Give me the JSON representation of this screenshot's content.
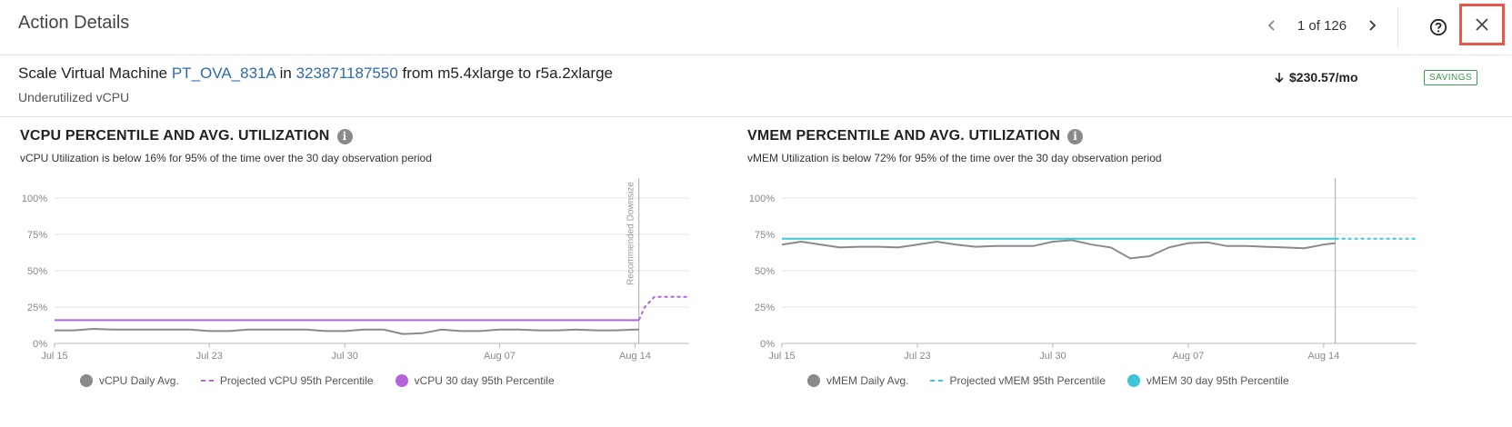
{
  "header": {
    "title": "Action Details",
    "pager_text": "1 of 126"
  },
  "summary": {
    "prefix": "Scale Virtual Machine ",
    "vm_link": "PT_OVA_831A",
    "in_text": " in ",
    "account_link": "323871187550",
    "suffix": " from m5.4xlarge to r5a.2xlarge",
    "reason": "Underutilized vCPU",
    "savings": "$230.57/mo",
    "badge": "SAVINGS"
  },
  "colors": {
    "link": "#2f6aa8",
    "daily_avg": "#8a8a8a",
    "vcpu_95th": "#b465dd",
    "vmem_95th": "#3fc5d6",
    "savings_badge": "#3f9a4a",
    "close_highlight": "#e8574c"
  },
  "icons": [
    "chevron-left-icon",
    "chevron-right-icon",
    "help-icon",
    "close-icon",
    "info-icon",
    "arrow-down-icon"
  ],
  "vcpu_panel": {
    "title": "VCPU PERCENTILE AND AVG. UTILIZATION",
    "subtitle": "vCPU Utilization is below 16% for 95% of the time over the 30 day observation period",
    "legend": [
      "vCPU Daily Avg.",
      "Projected vCPU 95th Percentile",
      "vCPU 30 day 95th Percentile"
    ]
  },
  "vmem_panel": {
    "title": "VMEM PERCENTILE AND AVG. UTILIZATION",
    "subtitle": "vMEM Utilization is below 72% for 95% of the time over the 30 day observation period",
    "legend": [
      "vMEM Daily Avg.",
      "Projected vMEM 95th Percentile",
      "vMEM 30 day 95th Percentile"
    ]
  },
  "chart_data": [
    {
      "type": "line",
      "yticks": [
        "100%",
        "75%",
        "50%",
        "25%",
        "0%"
      ],
      "ylim": [
        0,
        100
      ],
      "xlim": [
        0,
        32.8
      ],
      "xticks": [
        {
          "label": "Jul 15",
          "x": 0
        },
        {
          "label": "Jul 23",
          "x": 8
        },
        {
          "label": "Jul 30",
          "x": 15
        },
        {
          "label": "Aug 07",
          "x": 23
        },
        {
          "label": "Aug 14",
          "x": 30
        }
      ],
      "marker": {
        "label": "Recommended Downsize",
        "x": 30.2
      },
      "grid": true,
      "legend_position": "bottom",
      "series": [
        {
          "name": "vCPU Daily Avg.",
          "color": "#8a8a8a",
          "style": "solid",
          "x": [
            0,
            1,
            2,
            3,
            4,
            5,
            6,
            7,
            8,
            9,
            10,
            11,
            12,
            13,
            14,
            15,
            16,
            17,
            18,
            19,
            20,
            21,
            22,
            23,
            24,
            25,
            26,
            27,
            28,
            29,
            30,
            30.2
          ],
          "y": [
            9,
            9,
            10,
            9.5,
            9.5,
            9.5,
            9.5,
            9.5,
            8.5,
            8.5,
            9.5,
            9.5,
            9.5,
            9.5,
            8.5,
            8.5,
            9.5,
            9.5,
            6.5,
            7,
            9.5,
            8.5,
            8.5,
            9.5,
            9.5,
            9,
            9,
            9.5,
            9,
            9,
            9.5,
            9.5
          ]
        },
        {
          "name": "Projected vCPU 95th Percentile",
          "color": "#b465dd",
          "style": "dashed",
          "x": [
            30.2,
            30.5,
            31,
            32.8
          ],
          "y": [
            16,
            25,
            32,
            32
          ]
        },
        {
          "name": "vCPU 30 day 95th Percentile",
          "color": "#b465dd",
          "style": "solid",
          "x": [
            0,
            30.2
          ],
          "y": [
            16,
            16
          ]
        }
      ]
    },
    {
      "type": "line",
      "yticks": [
        "100%",
        "75%",
        "50%",
        "25%",
        "0%"
      ],
      "ylim": [
        0,
        100
      ],
      "xlim": [
        0,
        32.8
      ],
      "xticks": [
        {
          "label": "Jul 15",
          "x": 0
        },
        {
          "label": "Jul 23",
          "x": 7
        },
        {
          "label": "Jul 30",
          "x": 14
        },
        {
          "label": "Aug 07",
          "x": 21
        },
        {
          "label": "Aug 14",
          "x": 28
        }
      ],
      "marker": {
        "label": "",
        "x": 28.6
      },
      "grid": true,
      "legend_position": "bottom",
      "series": [
        {
          "name": "vMEM Daily Avg.",
          "color": "#8a8a8a",
          "style": "solid",
          "x": [
            0,
            1,
            2,
            3,
            4,
            5,
            6,
            7,
            8,
            9,
            10,
            11,
            12,
            13,
            14,
            15,
            16,
            17,
            18,
            19,
            20,
            21,
            22,
            23,
            24,
            25,
            26,
            27,
            28,
            28.6
          ],
          "y": [
            68,
            70,
            68,
            66,
            66.5,
            66.5,
            66,
            68,
            70,
            68,
            66.5,
            67,
            67,
            67,
            70,
            71,
            68,
            66,
            58.5,
            60,
            66,
            69,
            69.5,
            67,
            67,
            66.5,
            66,
            65.5,
            68,
            69
          ]
        },
        {
          "name": "Projected vMEM 95th Percentile",
          "color": "#3fc5d6",
          "style": "dashed",
          "x": [
            28.6,
            32.8
          ],
          "y": [
            72,
            72
          ]
        },
        {
          "name": "vMEM 30 day 95th Percentile",
          "color": "#3fc5d6",
          "style": "solid",
          "x": [
            0,
            28.6
          ],
          "y": [
            72,
            72
          ]
        }
      ]
    }
  ]
}
